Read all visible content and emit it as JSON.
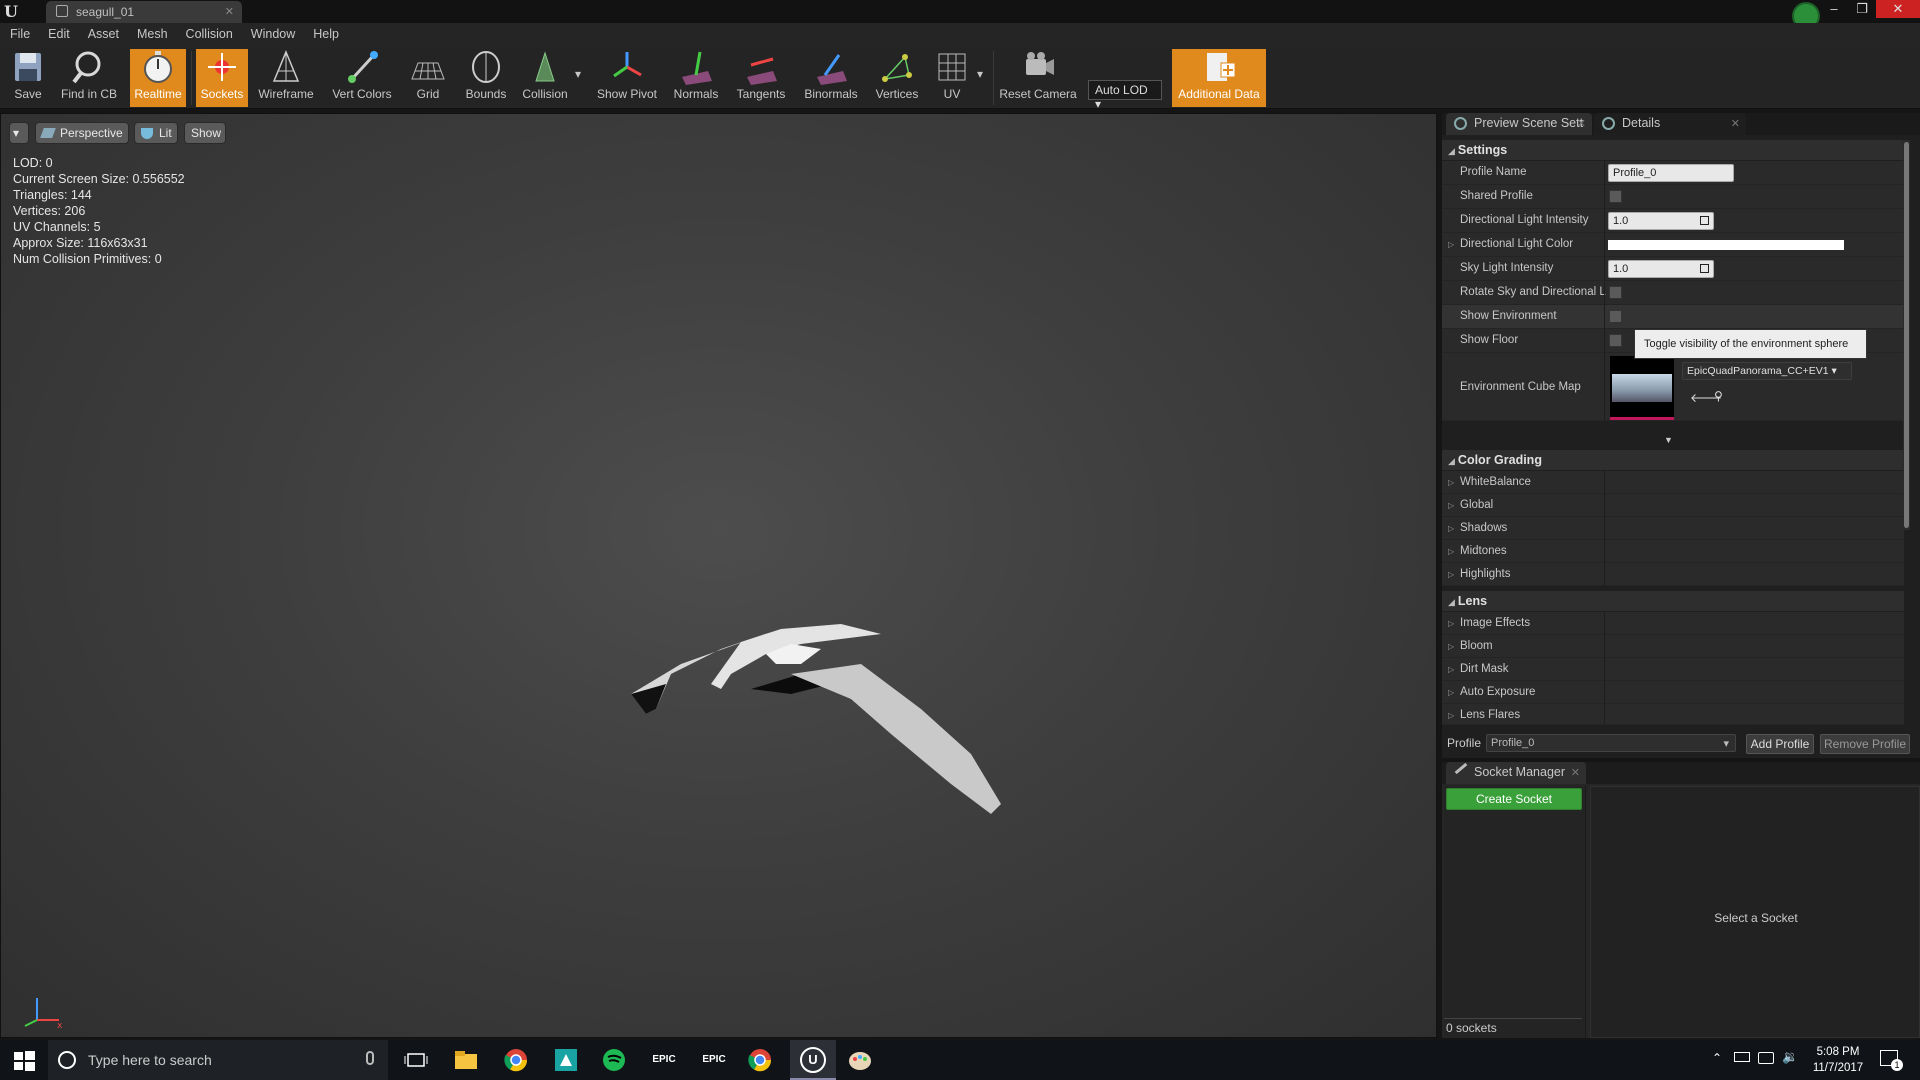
{
  "window": {
    "tab_title": "seagull_01",
    "tab_icon": "static-mesh-icon"
  },
  "menu": [
    "File",
    "Edit",
    "Asset",
    "Mesh",
    "Collision",
    "Window",
    "Help"
  ],
  "toolbar": {
    "save": "Save",
    "find_in_cb": "Find in CB",
    "realtime": "Realtime",
    "sockets": "Sockets",
    "wireframe": "Wireframe",
    "vert_colors": "Vert Colors",
    "grid": "Grid",
    "bounds": "Bounds",
    "collision": "Collision",
    "show_pivot": "Show Pivot",
    "normals": "Normals",
    "tangents": "Tangents",
    "binormals": "Binormals",
    "vertices": "Vertices",
    "uv": "UV",
    "reset_camera": "Reset Camera",
    "auto_lod": "Auto LOD",
    "additional_data": "Additional Data",
    "active_color": "#e08a1e"
  },
  "viewport": {
    "perspective": "Perspective",
    "lit": "Lit",
    "show": "Show",
    "stats": [
      "LOD:  0",
      "Current Screen Size:  0.556552",
      "Triangles:  144",
      "Vertices:  206",
      "UV Channels:  5",
      "Approx Size: 116x63x31",
      "Num Collision Primitives:  0"
    ]
  },
  "panel": {
    "tab_preview": "Preview Scene Sett",
    "tab_details": "Details",
    "settings_header": "Settings",
    "profile_name_label": "Profile Name",
    "profile_name_value": "Profile_0",
    "shared_profile_label": "Shared Profile",
    "dir_light_intensity_label": "Directional Light Intensity",
    "dir_light_intensity_value": "1.0",
    "dir_light_color_label": "Directional Light Color",
    "sky_light_intensity_label": "Sky Light Intensity",
    "sky_light_intensity_value": "1.0",
    "rotate_sky_label": "Rotate Sky and Directional L",
    "show_environment_label": "Show Environment",
    "show_floor_label": "Show Floor",
    "tooltip": "Toggle visibility of the environment sphere",
    "env_cube_map_label": "Environment Cube Map",
    "env_cube_map_value": "EpicQuadPanorama_CC+EV1",
    "color_grading_header": "Color Grading",
    "color_grading_items": [
      "WhiteBalance",
      "Global",
      "Shadows",
      "Midtones",
      "Highlights"
    ],
    "lens_header": "Lens",
    "lens_items": [
      "Image Effects",
      "Bloom",
      "Dirt Mask",
      "Auto Exposure",
      "Lens Flares"
    ],
    "profile_label": "Profile",
    "profile_value": "Profile_0",
    "add_profile": "Add Profile",
    "remove_profile": "Remove Profile"
  },
  "socket_manager": {
    "tab": "Socket Manager",
    "create_socket": "Create Socket",
    "select_socket": "Select a Socket",
    "count": "0 sockets",
    "create_color": "#3aa13a"
  },
  "taskbar": {
    "search_placeholder": "Type here to search",
    "time": "5:08 PM",
    "date": "11/7/2017",
    "notification_count": "1"
  }
}
